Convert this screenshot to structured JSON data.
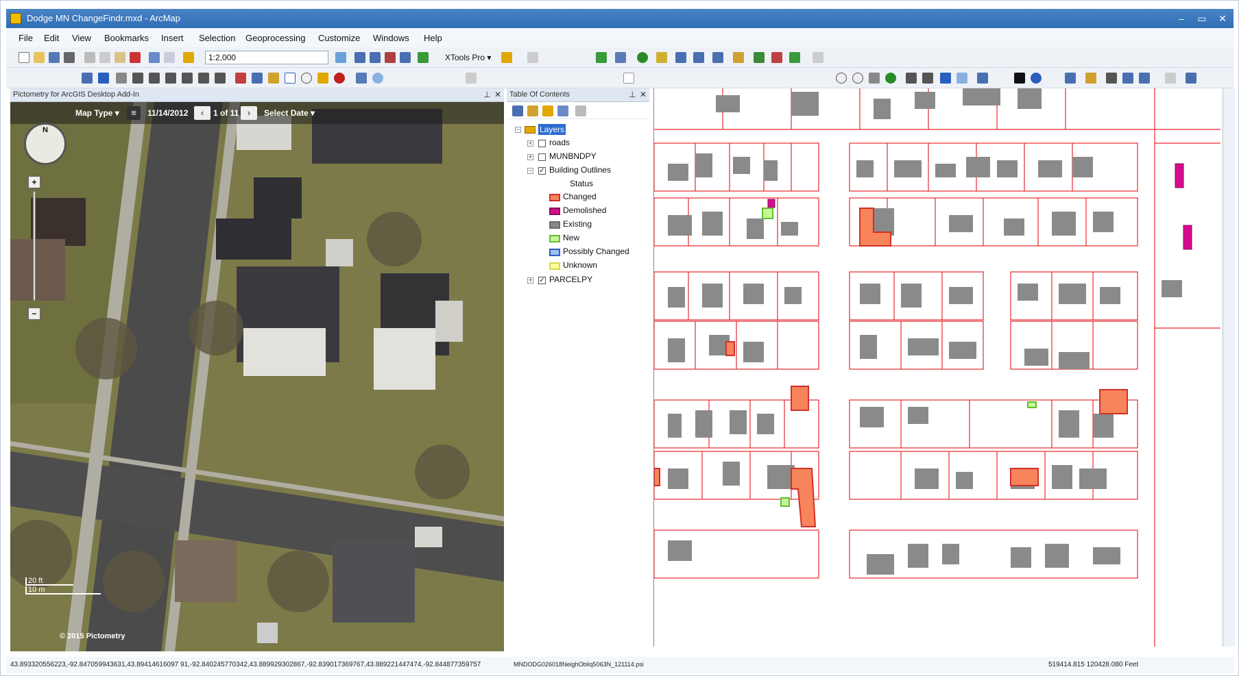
{
  "window": {
    "title": "Dodge MN ChangeFindr.mxd - ArcMap",
    "minimize": "–",
    "maximize": "▭",
    "close": "✕"
  },
  "menu": [
    "File",
    "Edit",
    "View",
    "Bookmarks",
    "Insert",
    "Selection",
    "Geoprocessing",
    "Customize",
    "Windows",
    "Help"
  ],
  "toolbar": {
    "scale_value": "1:2,000",
    "xtools_label": "XTools Pro ▾"
  },
  "pictometry": {
    "title": "Pictometry for ArcGIS Desktop Add-In",
    "map_type": "Map Type ▾",
    "date": "11/14/2012",
    "image_counter": "1 of 11",
    "select_date": "Select Date ▾",
    "prev": "‹",
    "next": "›",
    "compass_letter": "N",
    "scale_ft": "20 ft",
    "scale_m": "10 m",
    "copyright": "© 2015 Pictometry",
    "image_name": "MNDODG026018NeighObliq5063N_121114.psi"
  },
  "toc": {
    "title": "Table Of Contents",
    "layers_label": "Layers",
    "items": [
      {
        "label": "roads",
        "checked": false
      },
      {
        "label": "MUNBNDPY",
        "checked": false
      },
      {
        "label": "Building Outlines",
        "checked": true
      },
      {
        "label": "PARCELPY",
        "checked": true
      }
    ],
    "status_label": "Status",
    "legend": [
      {
        "label": "Changed",
        "fill": "#f7845a",
        "stroke": "#d0302a"
      },
      {
        "label": "Demolished",
        "fill": "#d60b8e",
        "stroke": "#8a0a5c"
      },
      {
        "label": "Existing",
        "fill": "#8a8a8a",
        "stroke": "#6a6a6a"
      },
      {
        "label": "New",
        "fill": "#c8f59a",
        "stroke": "#5fbf2a"
      },
      {
        "label": "Possibly Changed",
        "fill": "#9cc1f0",
        "stroke": "#2a5fbf"
      },
      {
        "label": "Unknown",
        "fill": "#ffff9a",
        "stroke": "#d8d850"
      }
    ],
    "pin": "📌",
    "close": "✕"
  },
  "status": {
    "coords": "43.893320556223,-92.847059943631,43.89414616097 91,-92.840245770342,43.889929302867,-92.839017369767,43.889221447474,-92.844877359757",
    "xy": "519414.815  120428.080 Feet"
  },
  "colors": {
    "parcel_line": "#e8282d",
    "building_existing": "#8a8a8a",
    "changed": "#f7845a",
    "demolished": "#d60b8e",
    "new": "#c8f59a"
  }
}
